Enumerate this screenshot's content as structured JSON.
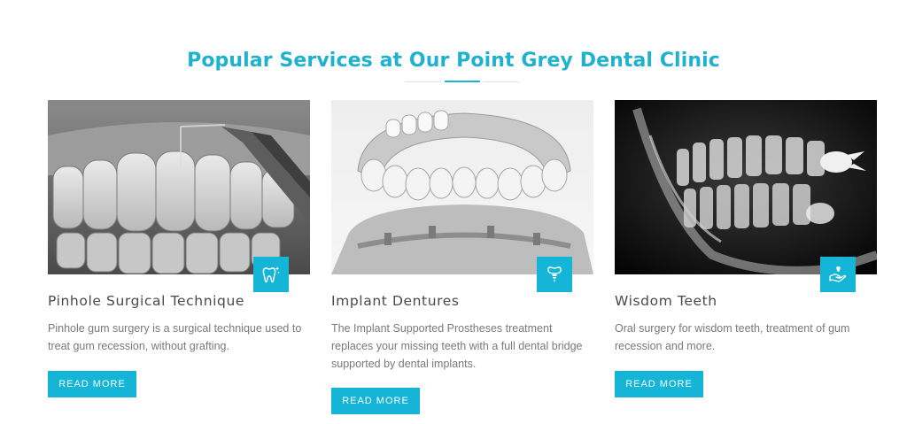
{
  "section": {
    "title": "Popular Services at Our Point Grey Dental Clinic"
  },
  "services": [
    {
      "name": "Pinhole Surgical Technique",
      "description": "Pinhole gum surgery is a surgical technique used to treat gum recession, without grafting.",
      "button": "READ MORE",
      "icon": "tooth-sparkle-icon"
    },
    {
      "name": "Implant Dentures",
      "description": "The Implant Supported Prostheses treatment replaces your missing teeth with a full dental bridge supported by dental implants.",
      "button": "READ MORE",
      "icon": "implant-icon"
    },
    {
      "name": "Wisdom Teeth",
      "description": "Oral surgery for wisdom teeth, treatment of gum recession and more.",
      "button": "READ MORE",
      "icon": "hand-tooth-icon"
    }
  ],
  "colors": {
    "accent": "#14b5d6",
    "title": "#1eb2cf",
    "heading": "#4a4a4a",
    "body_text": "#7a7a7a"
  }
}
